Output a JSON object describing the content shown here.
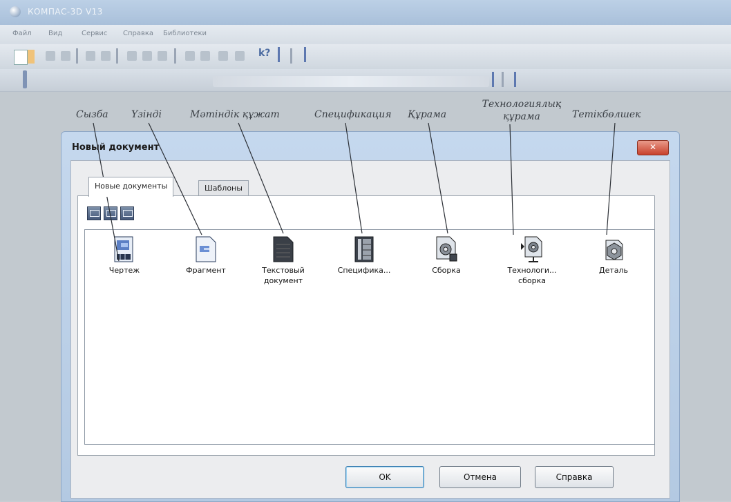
{
  "window": {
    "title": "КОМПАС-3D V13"
  },
  "menu": [
    "Файл",
    "Вид",
    "Сервис",
    "Справка",
    "Библиотеки"
  ],
  "annotations": [
    "Сызба",
    "Үзінді",
    "Мәтіндік құжат",
    "Спецификация",
    "Құрама",
    "Технологиялық құрама",
    "Тетікбөлшек"
  ],
  "dialog": {
    "title": "Новый документ",
    "close_label": "✕",
    "tabs": [
      "Новые документы",
      "Шаблоны"
    ],
    "items": [
      {
        "label": "Чертеж",
        "icon": "drawing-icon"
      },
      {
        "label": "Фрагмент",
        "icon": "fragment-icon"
      },
      {
        "label": "Текстовый документ",
        "icon": "text-document-icon"
      },
      {
        "label": "Специфика...",
        "icon": "specification-icon"
      },
      {
        "label": "Сборка",
        "icon": "assembly-icon"
      },
      {
        "label": "Технологи... сборка",
        "icon": "tech-assembly-icon"
      },
      {
        "label": "Деталь",
        "icon": "part-icon"
      }
    ],
    "buttons": {
      "ok": "OK",
      "cancel": "Отмена",
      "help": "Справка"
    }
  }
}
